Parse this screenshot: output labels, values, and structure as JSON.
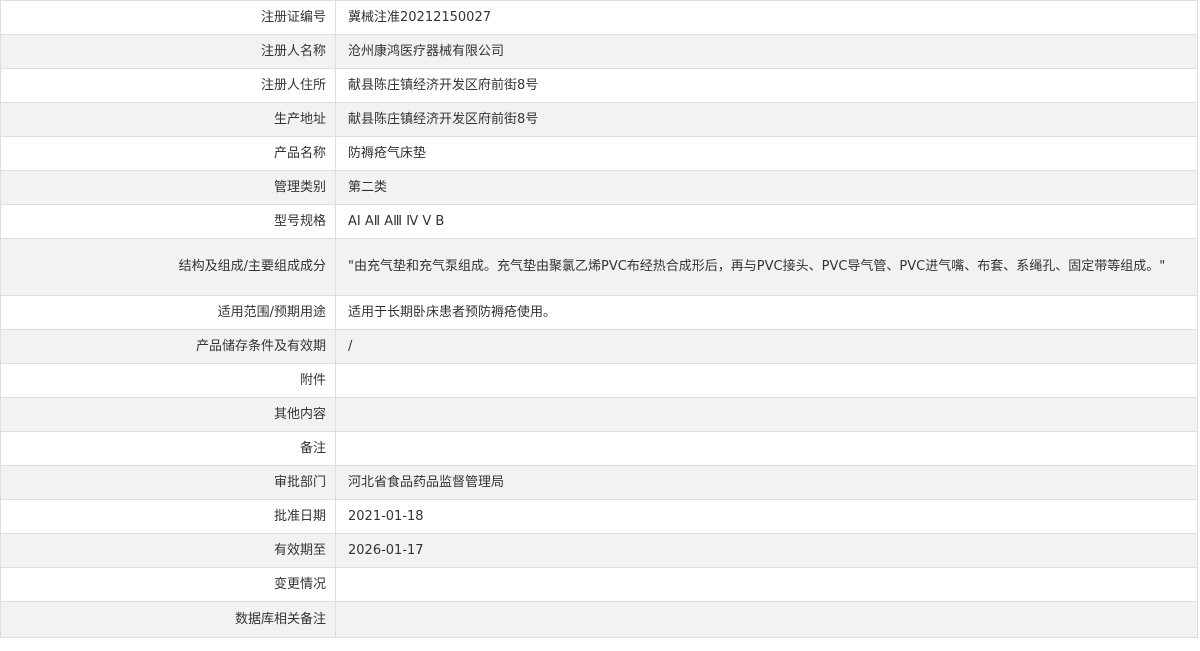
{
  "rows": [
    {
      "label": "注册证编号",
      "value": "冀械注准20212150027"
    },
    {
      "label": "注册人名称",
      "value": "沧州康鸿医疗器械有限公司"
    },
    {
      "label": "注册人住所",
      "value": "献县陈庄镇经济开发区府前街8号"
    },
    {
      "label": "生产地址",
      "value": "献县陈庄镇经济开发区府前街8号"
    },
    {
      "label": "产品名称",
      "value": "防褥疮气床垫"
    },
    {
      "label": "管理类别",
      "value": "第二类"
    },
    {
      "label": "型号规格",
      "value": "AⅠ AⅡ AⅢ Ⅳ Ⅴ B"
    },
    {
      "label": "结构及组成/主要组成成分",
      "value": "\"由充气垫和充气泵组成。充气垫由聚氯乙烯PVC布经热合成形后，再与PVC接头、PVC导气管、PVC进气嘴、布套、系绳孔、固定带等组成。\""
    },
    {
      "label": "适用范围/预期用途",
      "value": "适用于长期卧床患者预防褥疮使用。"
    },
    {
      "label": "产品储存条件及有效期",
      "value": "/"
    },
    {
      "label": "附件",
      "value": ""
    },
    {
      "label": "其他内容",
      "value": ""
    },
    {
      "label": "备注",
      "value": ""
    },
    {
      "label": "审批部门",
      "value": "河北省食品药品监督管理局"
    },
    {
      "label": "批准日期",
      "value": "2021-01-18"
    },
    {
      "label": "有效期至",
      "value": "2026-01-17"
    },
    {
      "label": "变更情况",
      "value": ""
    },
    {
      "label": "数据库相关备注",
      "value": ""
    }
  ]
}
